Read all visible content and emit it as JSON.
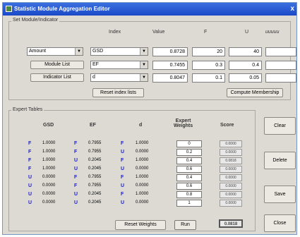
{
  "window": {
    "title": "Statistic Module Aggregation Editor",
    "close_glyph": "x"
  },
  "set_group": {
    "legend": "Set Module/Indicator",
    "headers": {
      "index": "Index",
      "value": "Value",
      "f": "F",
      "u": "U",
      "extra": "иииии"
    },
    "row1": {
      "combo_left": "Amount",
      "index": "GSD",
      "value": "0.8728",
      "f": "20",
      "u": "40"
    },
    "row2": {
      "button": "Module List",
      "index": "EF",
      "value": "0.7455",
      "f": "0.3",
      "u": "0.4"
    },
    "row3": {
      "button": "Indicator List",
      "index": "d",
      "value": "0.8047",
      "f": "0.1",
      "u": "0.05"
    },
    "reset_index_label": "Reset index lists",
    "compute_membership_label": "Compute Membership"
  },
  "expert_group": {
    "legend": "Expert Tables",
    "headers": {
      "gsd": "GSD",
      "ef": "EF",
      "d": "d",
      "weights": "Expert\nWeights",
      "score": "Score"
    },
    "rows": [
      {
        "gsd_fu": "F",
        "gsd_val": "1.0000",
        "ef_fu": "F",
        "ef_val": "0.7955",
        "d_fu": "F",
        "d_val": "1.0000",
        "weight": "0",
        "score": "0.0000"
      },
      {
        "gsd_fu": "F",
        "gsd_val": "1.0000",
        "ef_fu": "F",
        "ef_val": "0.7955",
        "d_fu": "U",
        "d_val": "0.0000",
        "weight": "0.2",
        "score": "0.0000"
      },
      {
        "gsd_fu": "F",
        "gsd_val": "1.0000",
        "ef_fu": "U",
        "ef_val": "0.2045",
        "d_fu": "F",
        "d_val": "1.0000",
        "weight": "0.4",
        "score": "0.0818"
      },
      {
        "gsd_fu": "F",
        "gsd_val": "1.0000",
        "ef_fu": "U",
        "ef_val": "0.2045",
        "d_fu": "U",
        "d_val": "0.0000",
        "weight": "0.6",
        "score": "0.0000"
      },
      {
        "gsd_fu": "U",
        "gsd_val": "0.0000",
        "ef_fu": "F",
        "ef_val": "0.7955",
        "d_fu": "F",
        "d_val": "1.0000",
        "weight": "0.4",
        "score": "0.0000"
      },
      {
        "gsd_fu": "U",
        "gsd_val": "0.0000",
        "ef_fu": "F",
        "ef_val": "0.7955",
        "d_fu": "U",
        "d_val": "0.0000",
        "weight": "0.6",
        "score": "0.0000"
      },
      {
        "gsd_fu": "U",
        "gsd_val": "0.0000",
        "ef_fu": "U",
        "ef_val": "0.2045",
        "d_fu": "F",
        "d_val": "1.0000",
        "weight": "0.8",
        "score": "0.0000"
      },
      {
        "gsd_fu": "U",
        "gsd_val": "0.0000",
        "ef_fu": "U",
        "ef_val": "0.2045",
        "d_fu": "U",
        "d_val": "0.0000",
        "weight": "1",
        "score": "0.0000"
      }
    ],
    "reset_weights_label": "Reset Weights",
    "run_label": "Run",
    "total_score": "0.0818"
  },
  "side_buttons": {
    "clear": "Clear",
    "delete": "Delete",
    "save": "Save",
    "close": "Close"
  },
  "colors": {
    "titlebar": "#1b49c7",
    "fu_text": "#2020d0",
    "window_bg": "#dcdad3"
  }
}
